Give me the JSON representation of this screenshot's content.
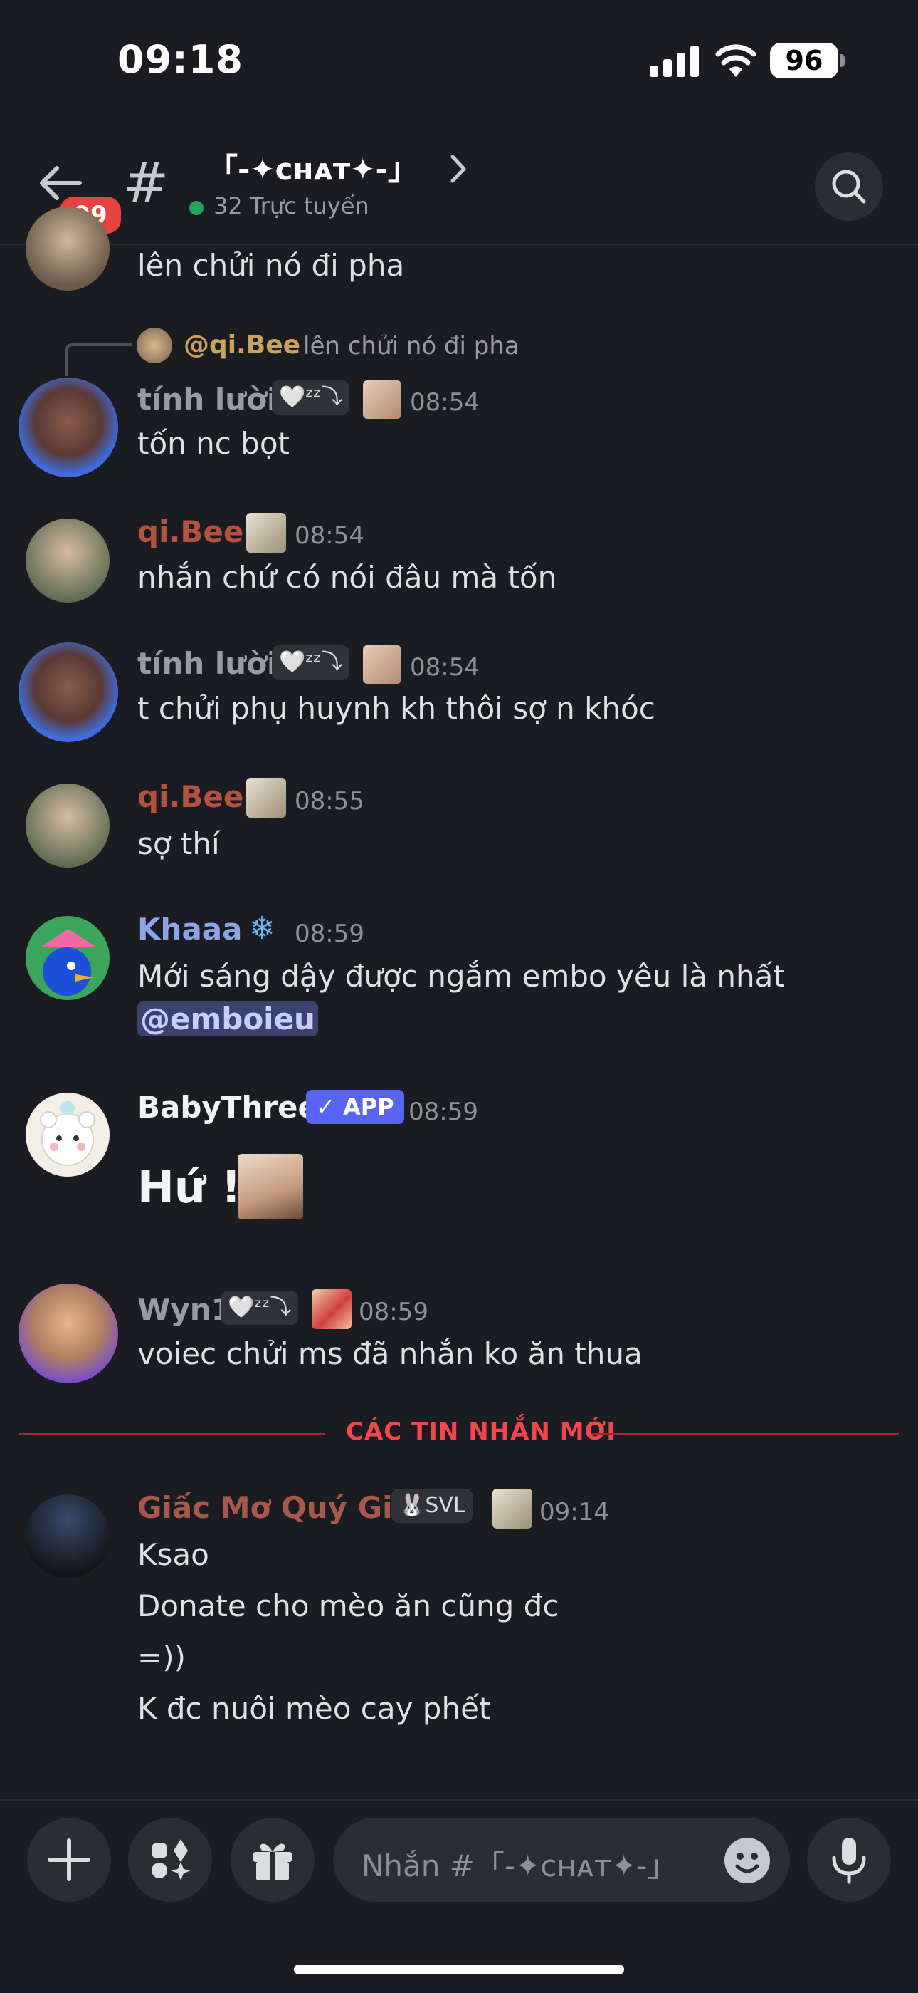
{
  "status_bar": {
    "time": "09:18",
    "battery": "96"
  },
  "header": {
    "unread_badge": "99",
    "hash": "#",
    "channel_name": "「-✦ᴄʜᴀᴛ✦-」",
    "online_text": "32 Trực tuyến"
  },
  "messages": {
    "m0_text": "lên chửi nó đi pha",
    "m1_reply_name": "@qi.Bee",
    "m1_reply_text": "lên chửi nó đi pha",
    "m1_name": "tính lười",
    "m1_tag": "🤍ᶻᶻ⤵",
    "m1_time": "08:54",
    "m1_text": "tốn nc bọt",
    "m2_name": "qi.Bee",
    "m2_time": "08:54",
    "m2_text": "nhắn chứ có nói đâu mà tốn",
    "m3_name": "tính lười",
    "m3_tag": "🤍ᶻᶻ⤵",
    "m3_time": "08:54",
    "m3_text": "t chửi phụ huynh kh thôi sợ n khóc",
    "m4_name": "qi.Bee",
    "m4_time": "08:55",
    "m4_text": "sợ thí",
    "m5_name": "Khaaa",
    "m5_icon": "❄",
    "m5_time": "08:59",
    "m5_text": "Mới sáng dậy được ngắm embo yêu là nhất",
    "m5_mention": "@emboieu",
    "m6_name": "BabyThree",
    "m6_app": "✓ APP",
    "m6_time": "08:59",
    "m6_text": "Hứ !",
    "m7_name": "Wyn1",
    "m7_tag": "🤍ᶻᶻ⤵",
    "m7_time": "08:59",
    "m7_text": "voiec chửi ms đã nhắn ko ăn thua",
    "new_messages_label": "CÁC TIN NHẮN MỚI",
    "m8_name": "Giấc Mơ Quý Giá",
    "m8_tag": "🐰SVL",
    "m8_time": "09:14",
    "m8_lines": [
      "Ksao",
      "Donate cho mèo ăn cũng đc",
      "=))",
      "K đc nuôi mèo cay phết"
    ]
  },
  "composer": {
    "placeholder": "Nhắn #「-✦ᴄʜᴀᴛ✦-」"
  },
  "colors": {
    "background": "#1b1c21",
    "qibee_name": "#b5513f",
    "khaaa_name": "#8fa4e8",
    "giac_name": "#a8584a",
    "new_divider": "#f0474a",
    "app_badge": "#5865f2",
    "online": "#23a55a"
  }
}
